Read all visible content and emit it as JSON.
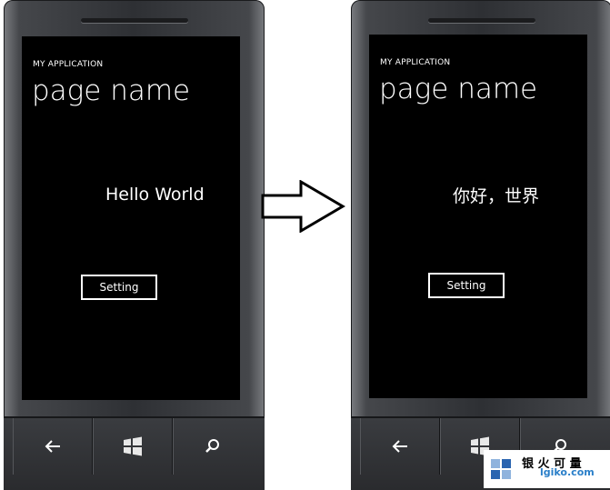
{
  "left_phone": {
    "app_title": "MY APPLICATION",
    "page_name": "page name",
    "content_text": "Hello World",
    "setting_button": "Setting"
  },
  "right_phone": {
    "app_title": "MY APPLICATION",
    "page_name": "page name",
    "content_text": "你好，世界",
    "setting_button": "Setting"
  },
  "nav_icons": [
    "back-icon",
    "windows-start-icon",
    "search-icon"
  ],
  "watermark": {
    "text": "银 火 可 量",
    "sub": "lgiko.com"
  },
  "colors": {
    "screen_bg": "#000000",
    "text": "#ffffff",
    "bezel": "#2e3034"
  }
}
